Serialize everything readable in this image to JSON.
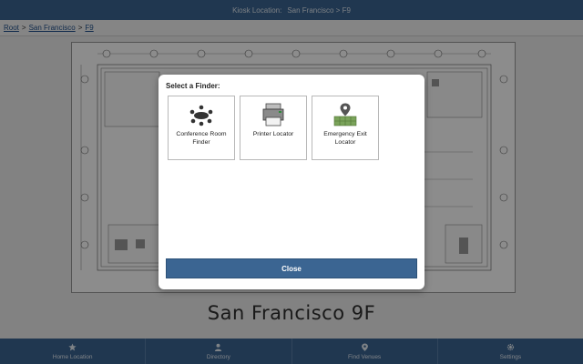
{
  "header": {
    "kiosk_label": "Kiosk Location:",
    "kiosk_location": "San Francisco > F9"
  },
  "breadcrumb": {
    "root": "Root",
    "separator": ">",
    "location": "San Francisco",
    "floor": "F9"
  },
  "floor_title": "San Francisco 9F",
  "modal": {
    "title": "Select a Finder:",
    "finders": [
      {
        "label": "Conference Room Finder",
        "icon": "conference-room-icon"
      },
      {
        "label": "Printer Locator",
        "icon": "printer-icon"
      },
      {
        "label": "Emergency Exit Locator",
        "icon": "emergency-exit-icon"
      }
    ],
    "close_label": "Close"
  },
  "bottom_nav": [
    {
      "label": "Home Location",
      "icon": "star-icon"
    },
    {
      "label": "Directory",
      "icon": "person-icon"
    },
    {
      "label": "Find Venues",
      "icon": "location-pin-icon"
    },
    {
      "label": "Settings",
      "icon": "gear-icon"
    }
  ],
  "colors": {
    "accent": "#3b6592",
    "overlay": "#000000"
  }
}
